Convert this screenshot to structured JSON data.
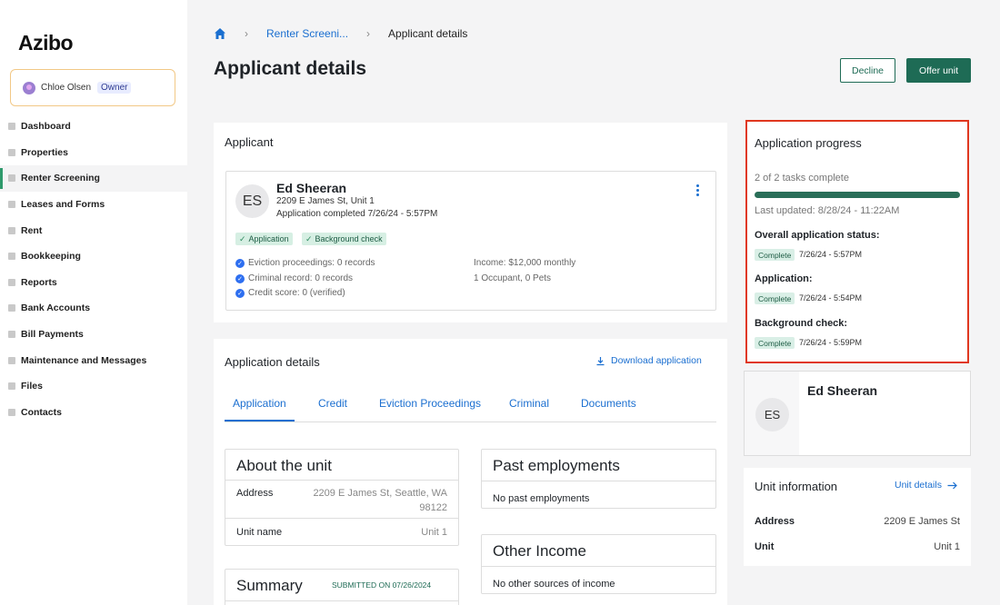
{
  "sidebar": {
    "logo": "Azibo",
    "user": {
      "name": "Chloe Olsen",
      "role": "Owner"
    },
    "items": [
      {
        "label": "Dashboard",
        "icon": "home-icon"
      },
      {
        "label": "Properties",
        "icon": "building-icon"
      },
      {
        "label": "Renter Screening",
        "icon": "screening-icon"
      },
      {
        "label": "Leases and Forms",
        "icon": "document-icon"
      },
      {
        "label": "Rent",
        "icon": "rent-icon"
      },
      {
        "label": "Bookkeeping",
        "icon": "book-icon"
      },
      {
        "label": "Reports",
        "icon": "report-icon"
      },
      {
        "label": "Bank Accounts",
        "icon": "bank-icon"
      },
      {
        "label": "Bill Payments",
        "icon": "bill-icon"
      },
      {
        "label": "Maintenance and Messages",
        "icon": "wrench-icon"
      },
      {
        "label": "Files",
        "icon": "folder-icon"
      },
      {
        "label": "Contacts",
        "icon": "contacts-icon"
      }
    ]
  },
  "breadcrumb": {
    "parent": "Renter Screeni...",
    "current": "Applicant details"
  },
  "header": {
    "title": "Applicant details",
    "decline": "Decline",
    "offer": "Offer unit"
  },
  "applicant": {
    "section_title": "Applicant",
    "initials": "ES",
    "name": "Ed Sheeran",
    "address": "2209 E James St, Unit 1",
    "completed": "Application completed 7/26/24 - 5:57PM",
    "chips": [
      "Application",
      "Background check"
    ],
    "facts_left": [
      "Eviction proceedings: 0 records",
      "Criminal record: 0 records",
      "Credit score: 0 (verified)"
    ],
    "facts_right": [
      "Income: $12,000 monthly",
      "1 Occupant, 0 Pets"
    ]
  },
  "details": {
    "title": "Application details",
    "download": "Download application",
    "tabs": [
      "Application",
      "Credit",
      "Eviction Proceedings",
      "Criminal",
      "Documents"
    ],
    "about": {
      "title": "About the unit",
      "address_label": "Address",
      "address_line1": "2209 E James St, Seattle, WA",
      "address_line2": "98122",
      "unit_label": "Unit name",
      "unit_value": "Unit 1"
    },
    "summary": {
      "title": "Summary",
      "submitted": "SUBMITTED ON 07/26/2024"
    },
    "employment": {
      "title": "Past employments",
      "empty": "No past employments"
    },
    "income": {
      "title": "Other Income",
      "empty": "No other sources of income"
    }
  },
  "progress": {
    "title": "Application progress",
    "tasks": "2 of 2 tasks complete",
    "progress_fraction": 1.0,
    "updated": "Last updated: 8/28/24 - 11:22AM",
    "statuses": [
      {
        "label": "Overall application status:",
        "badge": "Complete",
        "time": "7/26/24 - 5:57PM"
      },
      {
        "label": "Application:",
        "badge": "Complete",
        "time": "7/26/24 - 5:54PM"
      },
      {
        "label": "Background check:",
        "badge": "Complete",
        "time": "7/26/24 - 5:59PM"
      }
    ]
  },
  "profile": {
    "initials": "ES",
    "name": "Ed Sheeran"
  },
  "unit_info": {
    "title": "Unit information",
    "link": "Unit details",
    "address_label": "Address",
    "address_value": "2209 E James St",
    "unit_label": "Unit",
    "unit_value": "Unit 1"
  },
  "colors": {
    "brand": "#1e6b55",
    "link": "#1b6fd0",
    "highlight": "#e0371f",
    "complete_bg": "#d9efe6"
  }
}
